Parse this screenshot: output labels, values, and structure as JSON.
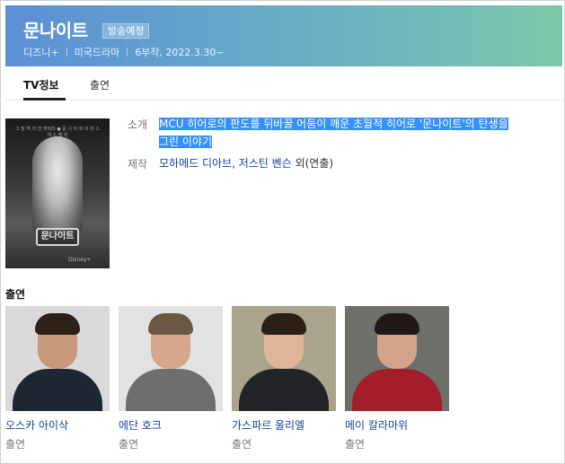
{
  "header": {
    "title": "문나이트",
    "badge": "방송예정",
    "meta": [
      "디즈니+",
      "미국드라마",
      "6부작, 2022.3.30~"
    ]
  },
  "tabs": [
    {
      "label": "TV정보",
      "active": true
    },
    {
      "label": "출연",
      "active": false
    }
  ],
  "poster": {
    "top_text": "그 정 역 의 한 캐릭터 ● 문 나 이 트 이 미 스 캐 스 텔 라",
    "logo_text": "문나이트",
    "brand_text": "Disney+"
  },
  "info": {
    "synopsis_label": "소개",
    "synopsis_line1": "MCU 히어로의 판도를 뒤바꿀 어둠이 깨운 초월적 히어로 '문나이트'의 탄생을",
    "synopsis_line2": "그린 이야기",
    "production_label": "제작",
    "directors": "모하메드 디아브, 저스틴 벤슨",
    "directors_suffix": " 외(연출)"
  },
  "cast": {
    "heading": "출연",
    "members": [
      {
        "name": "오스카 아이삭",
        "role": "출연",
        "bg": "#d9d9d9",
        "skin": "#c9977a",
        "hair": "#2b2118",
        "suit": "#1e2533"
      },
      {
        "name": "에단 호크",
        "role": "출연",
        "bg": "#e2e2e2",
        "skin": "#d6a78a",
        "hair": "#6b5844",
        "suit": "#6e6e6e"
      },
      {
        "name": "가스파르 울리엘",
        "role": "출연",
        "bg": "#a9a58c",
        "skin": "#e0b59a",
        "hair": "#2a2018",
        "suit": "#222428"
      },
      {
        "name": "메이 칼라마위",
        "role": "출연",
        "bg": "#6c7068",
        "skin": "#d4a48a",
        "hair": "#1f1814",
        "suit": "#a31d2a"
      }
    ]
  },
  "colors": {
    "header_gradient_start": "#5b8fd6",
    "header_gradient_end": "#7bc8a9",
    "link": "#1a3f9b",
    "selection": "#3390ff"
  }
}
